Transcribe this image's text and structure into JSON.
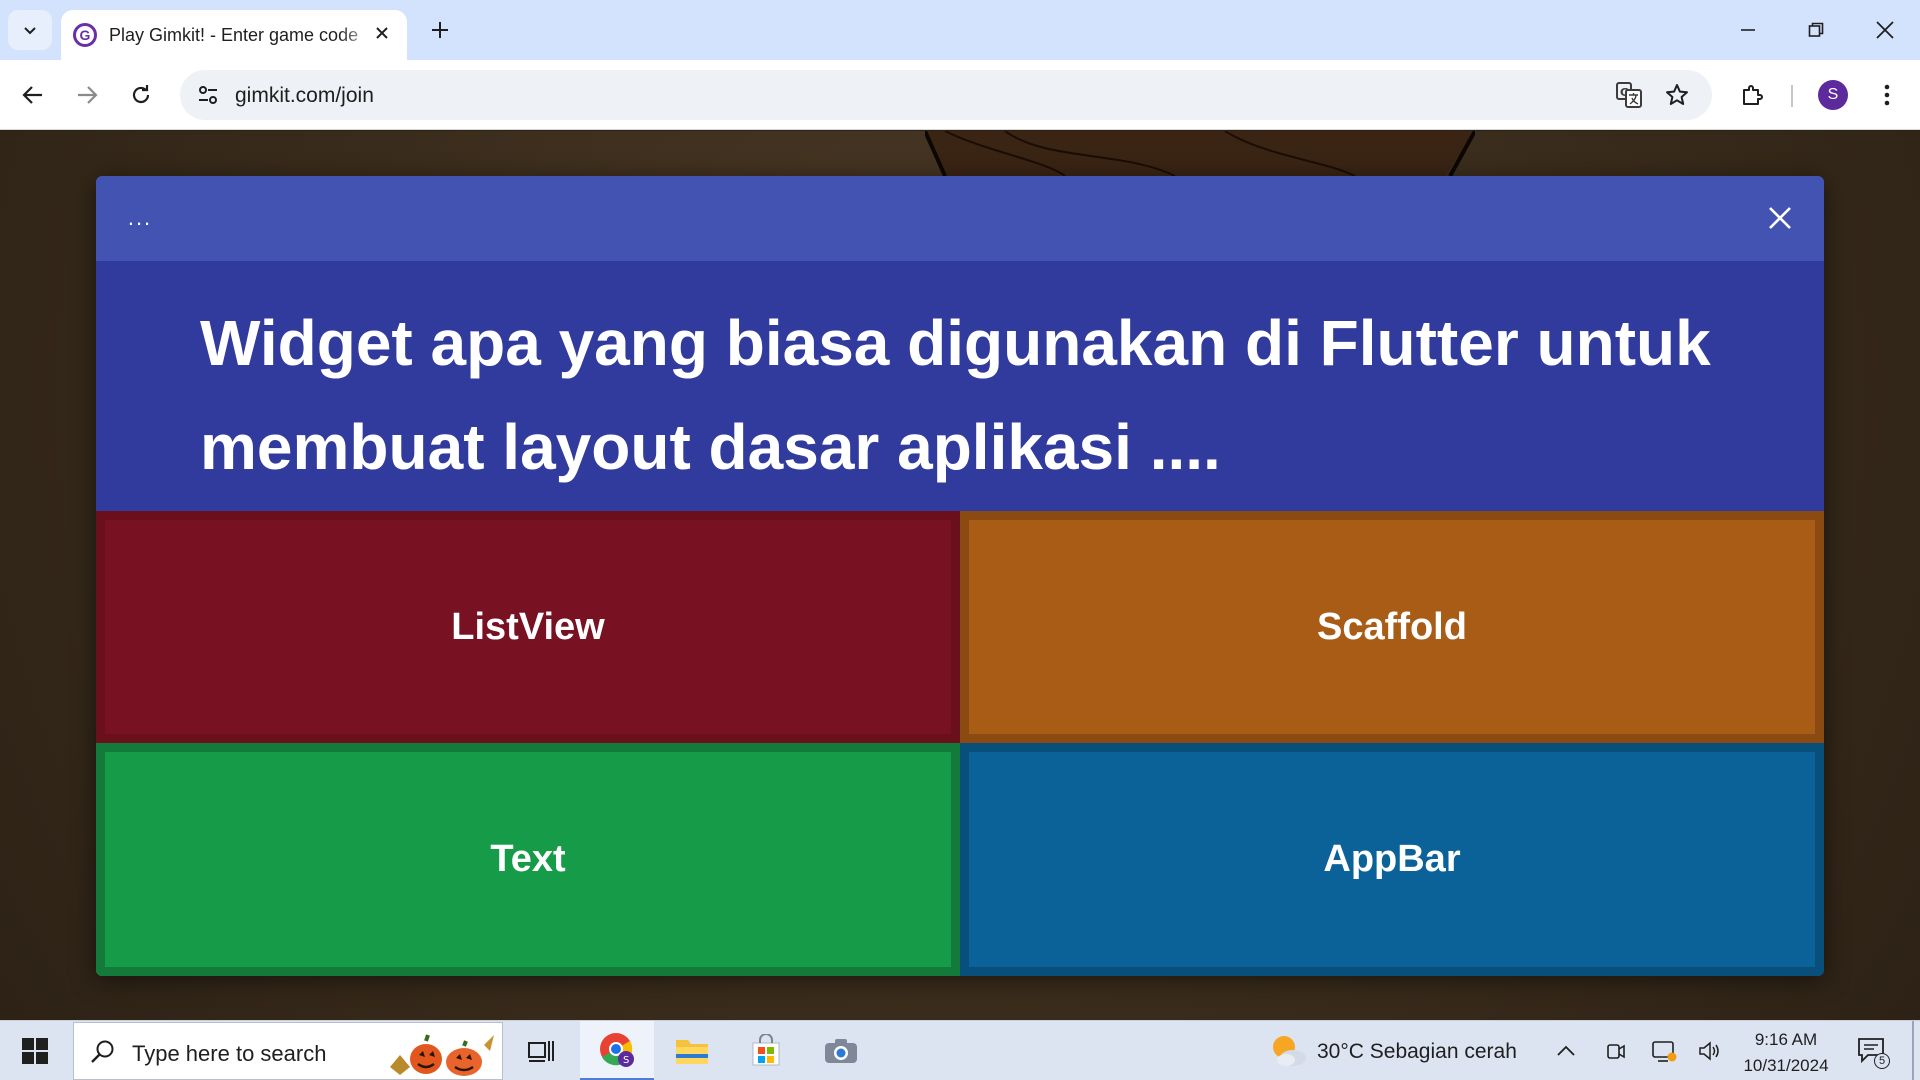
{
  "browser": {
    "tab_title": "Play Gimkit! - Enter game code",
    "favicon_letter": "G",
    "url": "gimkit.com/join",
    "profile_initial": "S"
  },
  "modal": {
    "menu_label": "...",
    "question": "Widget apa yang biasa digunakan di Flutter untuk membuat layout dasar aplikasi ....",
    "answers": [
      {
        "label": "ListView",
        "color": "#781121",
        "border": "#6a0f1c"
      },
      {
        "label": "Scaffold",
        "color": "#a95c16",
        "border": "#8a4a12"
      },
      {
        "label": "Text",
        "color": "#169c49",
        "border": "#137a3b"
      },
      {
        "label": "AppBar",
        "color": "#0a6299",
        "border": "#084f7c"
      }
    ]
  },
  "taskbar": {
    "search_placeholder": "Type here to search",
    "weather": "30°C  Sebagian cerah",
    "time": "9:16 AM",
    "date": "10/31/2024",
    "notification_count": "5"
  }
}
